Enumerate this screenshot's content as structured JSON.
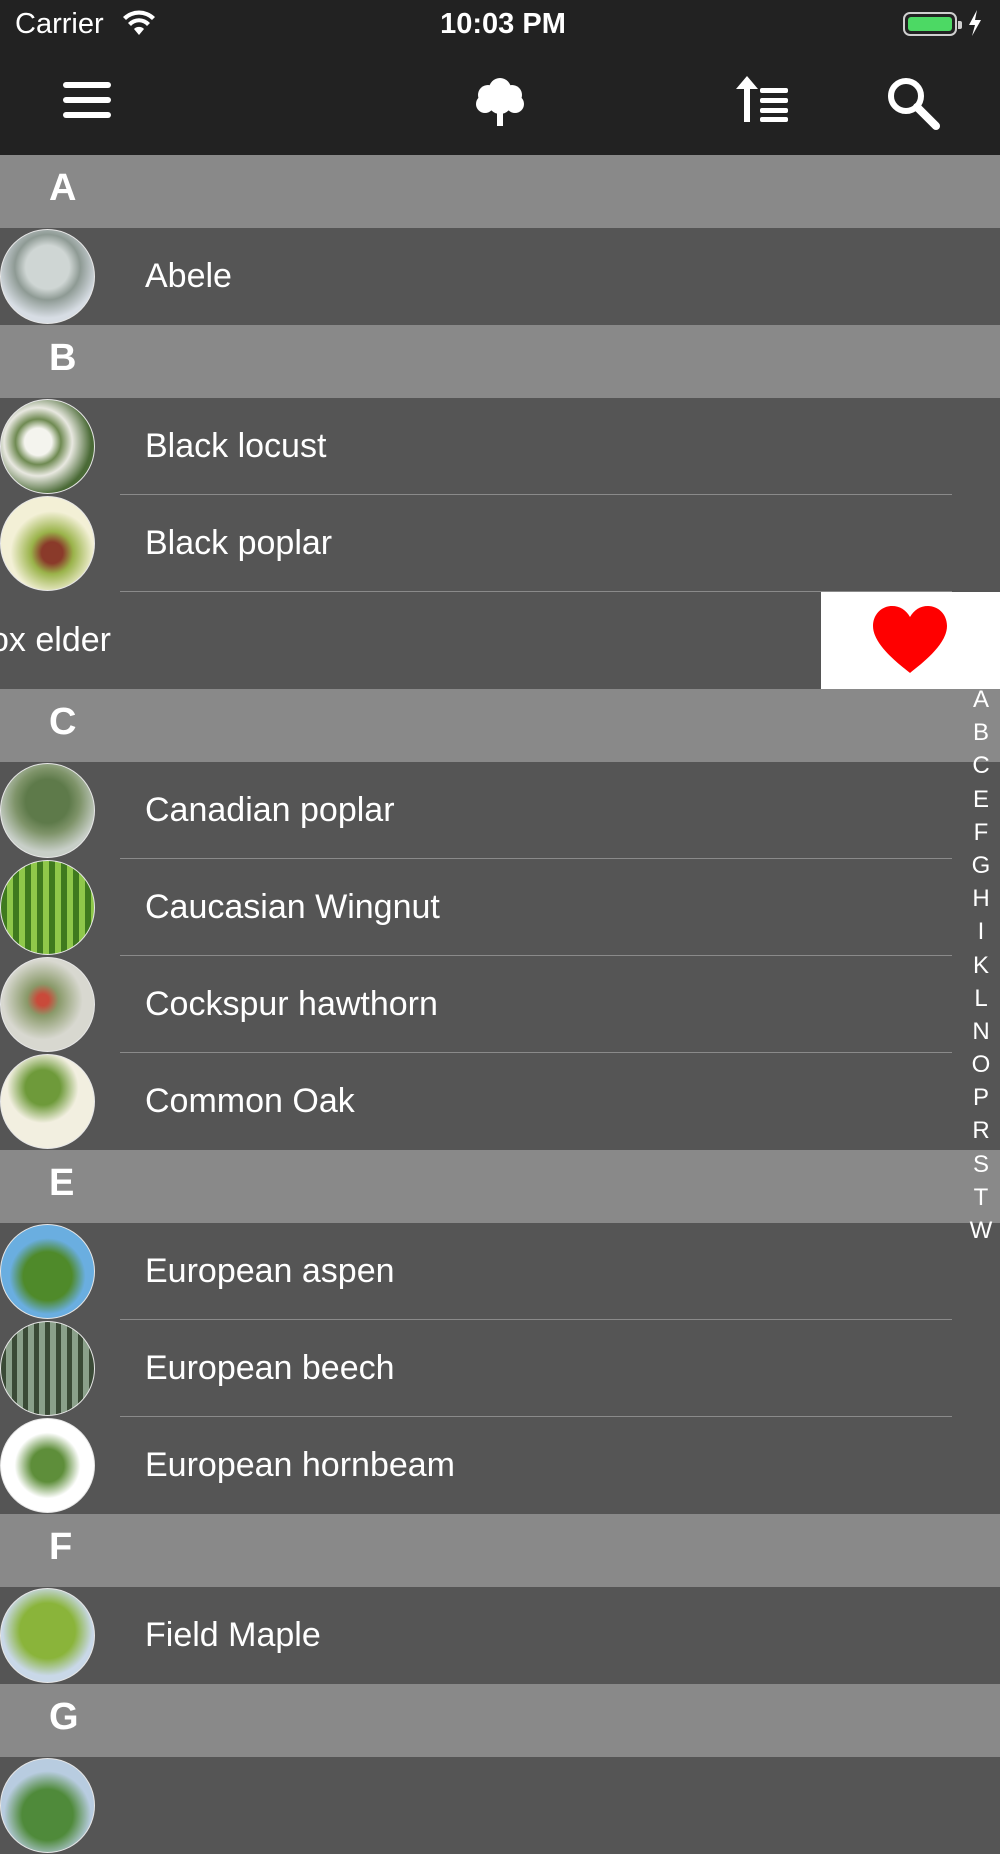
{
  "status_bar": {
    "carrier": "Carrier",
    "time": "10:03 PM"
  },
  "nav": {
    "menu_icon": "hamburger-menu-icon",
    "center_icon": "tree-icon",
    "sort_icon": "sort-ascending-icon",
    "search_icon": "search-icon"
  },
  "colors": {
    "nav_bg": "#222222",
    "section_bg": "#898989",
    "row_bg": "#555555",
    "favorite_heart": "#ff0000",
    "battery_fill": "#4cd964"
  },
  "sections": [
    {
      "letter": "A",
      "items": [
        {
          "name": "Abele"
        }
      ]
    },
    {
      "letter": "B",
      "items": [
        {
          "name": "Black locust"
        },
        {
          "name": "Black poplar"
        },
        {
          "name": "Box elder",
          "visible_text": "ox elder",
          "swiped": true
        }
      ]
    },
    {
      "letter": "C",
      "items": [
        {
          "name": "Canadian poplar"
        },
        {
          "name": "Caucasian Wingnut"
        },
        {
          "name": "Cockspur hawthorn"
        },
        {
          "name": "Common Oak"
        }
      ]
    },
    {
      "letter": "E",
      "items": [
        {
          "name": "European aspen"
        },
        {
          "name": "European beech"
        },
        {
          "name": "European hornbeam"
        }
      ]
    },
    {
      "letter": "F",
      "items": [
        {
          "name": "Field Maple"
        }
      ]
    },
    {
      "letter": "G",
      "items": []
    }
  ],
  "swipe_action": {
    "icon": "heart-icon"
  },
  "index_letters": [
    "A",
    "B",
    "C",
    "E",
    "F",
    "G",
    "H",
    "I",
    "K",
    "L",
    "N",
    "O",
    "P",
    "R",
    "S",
    "T",
    "W"
  ]
}
